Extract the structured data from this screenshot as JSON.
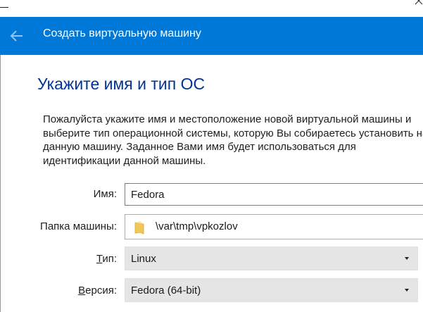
{
  "window": {
    "title": "Создать виртуальную машину"
  },
  "page": {
    "heading": "Укажите имя и тип ОС",
    "description_lines": [
      "Пожалуйста укажите имя и местоположение новой виртуальной машины и",
      "выберите тип операционной системы, которую Вы собираетесь установить на",
      "данную машину. Заданное Вами имя будет использоваться для",
      "идентификации данной машины."
    ]
  },
  "form": {
    "name": {
      "label": "Имя:",
      "value": "Fedora"
    },
    "folder": {
      "label": "Папка машины:",
      "value": "\\var\\tmp\\vpkozlov",
      "icon": "folder-icon"
    },
    "type": {
      "label_accel": "Т",
      "label_rest": "ип:",
      "value": "Linux"
    },
    "version": {
      "label_accel": "В",
      "label_rest": "ерсия:",
      "value": "Fedora (64-bit)"
    }
  },
  "colors": {
    "titlebar": "#0078d7",
    "heading": "#003399",
    "combo_bg": "#e5e5e5",
    "folder_icon": "#f0c85a"
  },
  "icons": [
    "back-arrow-icon",
    "folder-icon",
    "chevron-down-icon",
    "close-icon"
  ]
}
